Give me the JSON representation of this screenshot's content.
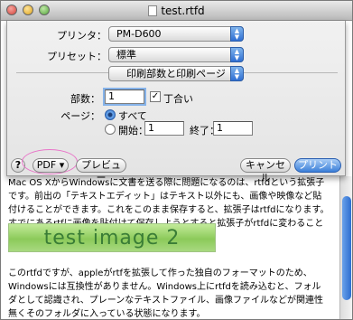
{
  "window": {
    "title": "test.rtfd"
  },
  "dialog": {
    "printer_label": "プリンタ：",
    "printer_value": "PM-D600",
    "preset_label": "プリセット：",
    "preset_value": "標準",
    "pane_value": "印刷部数と印刷ページ",
    "copies_label": "部数：",
    "copies_value": "1",
    "collate_label": "丁合い",
    "pages_label": "ページ：",
    "all_label": "すべて",
    "from_label": "開始：",
    "from_value": "1",
    "to_label": "終了：",
    "to_value": "1",
    "help_label": "?",
    "pdf_label": "PDF ▾",
    "preview_label": "プレビュー",
    "cancel_label": "キャンセル",
    "print_label": "プリント"
  },
  "document": {
    "paragraph1": "Mac OS XからWindowsに文書を送る際に問題になるのは、rtfdという拡張子です。前出の「テキストエディット」はテキスト以外にも、画像や映像など貼付けることができます。これをこのまま保存すると、拡張子はrtfdになります。すでにあるrtfに画像を貼付けて保存しようとすると拡張子がrtfdに変わることを知らせるワーニングが出ます。",
    "banner_text": "test image 2",
    "paragraph2": "このrtfdですが、appleがrtfを拡張して作った独自のフォーマットのため、Windowsには互換性がありません。Windows上にrtfdを読み込むと、フォルダとして認識され、プレーンなテキストファイル、画像ファイルなどが関連性無くそのフォルダに入っている状態になります。"
  }
}
